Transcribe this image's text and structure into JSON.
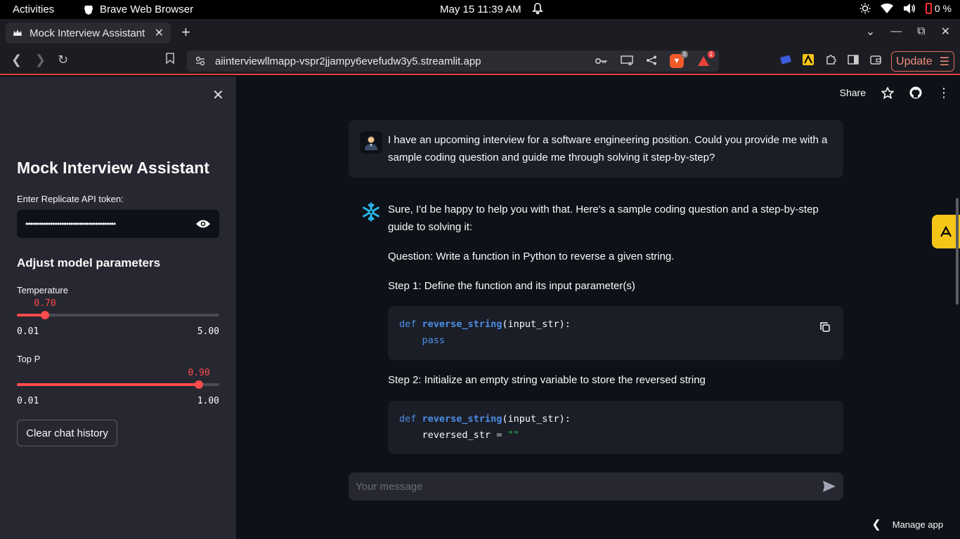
{
  "os_bar": {
    "activities": "Activities",
    "app_name": "Brave Web Browser",
    "clock": "May 15  11:39 AM",
    "battery": "0 %"
  },
  "browser": {
    "tab_title": "Mock Interview Assistant",
    "url": "aiinterviewllmapp-vspr2jjampy6evefudw3y5.streamlit.app",
    "brave_shield_count": "3",
    "rewards_count": "1",
    "update_label": "Update"
  },
  "sidebar": {
    "title": "Mock Interview Assistant",
    "token_label": "Enter Replicate API token:",
    "token_value": "••••••••••••••••••••••••••••••••••••••••",
    "params_title": "Adjust model parameters",
    "temperature": {
      "label": "Temperature",
      "value": 0.7,
      "value_text": "0.70",
      "min": "0.01",
      "max": "5.00",
      "fraction": 0.138
    },
    "top_p": {
      "label": "Top P",
      "value": 0.9,
      "value_text": "0.90",
      "min": "0.01",
      "max": "1.00",
      "fraction": 0.899
    },
    "clear_label": "Clear chat history"
  },
  "header": {
    "share_label": "Share"
  },
  "chat": {
    "user_message": "I have an upcoming interview for a software engineering position. Could you provide me with a sample coding question and guide me through solving it step-by-step?",
    "assistant_intro": "Sure, I'd be happy to help you with that. Here's a sample coding question and a step-by-step guide to solving it:",
    "question": "Question: Write a function in Python to reverse a given string.",
    "step1": "Step 1: Define the function and its input parameter(s)",
    "code1": {
      "kw": "def",
      "fn": "reverse_string",
      "args": "(input_str):",
      "body": "pass"
    },
    "step2": "Step 2: Initialize an empty string variable to store the reversed string",
    "code2": {
      "kw": "def",
      "fn": "reverse_string",
      "args": "(input_str):",
      "var": "reversed_str",
      "op": "=",
      "str": "\"\""
    },
    "input_placeholder": "Your message"
  },
  "footer": {
    "manage_app": "Manage app"
  },
  "colors": {
    "accent": "#ff4b4b",
    "background": "#0e1117",
    "sidebar": "#262730"
  }
}
